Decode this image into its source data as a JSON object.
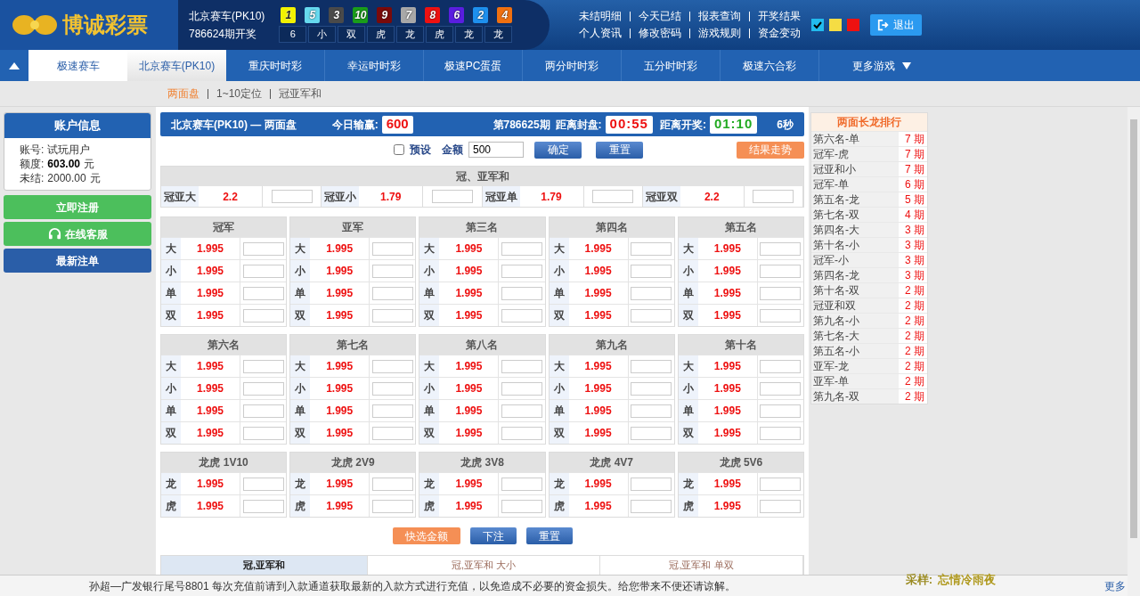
{
  "header": {
    "logo": "博诚彩票",
    "game": "北京赛车(PK10)",
    "issue": "786624期开奖",
    "balls": [
      {
        "number": "1",
        "color": "#f2f200"
      },
      {
        "number": "5",
        "color": "#66d9ee"
      },
      {
        "number": "3",
        "color": "#4a4a4a"
      },
      {
        "number": "10",
        "color": "#1a9e1a"
      },
      {
        "number": "9",
        "color": "#7a0a0a"
      },
      {
        "number": "7",
        "color": "#a8a8a8"
      },
      {
        "number": "8",
        "color": "#ee1111"
      },
      {
        "number": "6",
        "color": "#5a1ee0"
      },
      {
        "number": "2",
        "color": "#1e90ee"
      },
      {
        "number": "4",
        "color": "#f07010"
      }
    ],
    "stats": [
      "6",
      "小",
      "双",
      "虎",
      "龙",
      "虎",
      "龙",
      "龙"
    ],
    "links": [
      [
        "未结明细",
        "今天已结",
        "报表查询",
        "开奖结果"
      ],
      [
        "个人资讯",
        "修改密码",
        "游戏规则",
        "资金变动"
      ]
    ],
    "swatches": [
      {
        "color": "#22bbee",
        "selected": true
      },
      {
        "color": "#f5dd44",
        "selected": false
      },
      {
        "color": "#ee1111",
        "selected": false
      }
    ],
    "logout": "退出"
  },
  "nav": {
    "tabs": [
      {
        "label": "极速赛车",
        "selected": false
      },
      {
        "label": "北京赛车(PK10)",
        "selected": true
      },
      {
        "label": "重庆时时彩",
        "selected": false
      },
      {
        "label": "幸运时时彩",
        "selected": false
      },
      {
        "label": "极速PC蛋蛋",
        "selected": false
      },
      {
        "label": "两分时时彩",
        "selected": false
      },
      {
        "label": "五分时时彩",
        "selected": false
      },
      {
        "label": "极速六合彩",
        "selected": false
      }
    ],
    "more": "更多游戏"
  },
  "subnav": [
    {
      "label": "两面盘",
      "selected": true
    },
    {
      "label": "1~10定位",
      "selected": false
    },
    {
      "label": "冠亚军和",
      "selected": false
    }
  ],
  "account": {
    "title": "账户信息",
    "rows": [
      {
        "label": "账号:",
        "value": "试玩用户",
        "unit": "",
        "bold": false
      },
      {
        "label": "额度:",
        "value": "603.00",
        "unit": "元",
        "bold": true
      },
      {
        "label": "未结:",
        "value": "2000.00",
        "unit": "元",
        "bold": false
      }
    ],
    "buttons": [
      {
        "label": "立即注册",
        "color": "#4cbf5c",
        "icon": false
      },
      {
        "label": "在线客服",
        "color": "#4cbf5c",
        "icon": true
      },
      {
        "label": "最新注单",
        "color": "#2a5ea8",
        "icon": false
      }
    ]
  },
  "bar": {
    "title": "北京赛车(PK10) — 两面盘",
    "profit_label": "今日输赢:",
    "profit": "600",
    "period": "第786625期",
    "close_label": "距离封盘:",
    "close": "00:55",
    "draw_label": "距离开奖:",
    "draw": "01:10",
    "refresh": "6秒"
  },
  "toolbar": {
    "preset_checked": false,
    "preset": "预设",
    "amount_label": "金额",
    "amount": "500",
    "confirm": "确定",
    "reset": "重置",
    "trend": "结果走势"
  },
  "sum": {
    "title": "冠、亚军和",
    "items": [
      {
        "label": "冠亚大",
        "odds": "2.2"
      },
      {
        "label": "冠亚小",
        "odds": "1.79"
      },
      {
        "label": "冠亚单",
        "odds": "1.79"
      },
      {
        "label": "冠亚双",
        "odds": "2.2"
      }
    ]
  },
  "positions": [
    {
      "title": "冠军",
      "rows": [
        {
          "label": "大",
          "odds": "1.995"
        },
        {
          "label": "小",
          "odds": "1.995"
        },
        {
          "label": "单",
          "odds": "1.995"
        },
        {
          "label": "双",
          "odds": "1.995"
        }
      ]
    },
    {
      "title": "亚军",
      "rows": [
        {
          "label": "大",
          "odds": "1.995"
        },
        {
          "label": "小",
          "odds": "1.995"
        },
        {
          "label": "单",
          "odds": "1.995"
        },
        {
          "label": "双",
          "odds": "1.995"
        }
      ]
    },
    {
      "title": "第三名",
      "rows": [
        {
          "label": "大",
          "odds": "1.995"
        },
        {
          "label": "小",
          "odds": "1.995"
        },
        {
          "label": "单",
          "odds": "1.995"
        },
        {
          "label": "双",
          "odds": "1.995"
        }
      ]
    },
    {
      "title": "第四名",
      "rows": [
        {
          "label": "大",
          "odds": "1.995"
        },
        {
          "label": "小",
          "odds": "1.995"
        },
        {
          "label": "单",
          "odds": "1.995"
        },
        {
          "label": "双",
          "odds": "1.995"
        }
      ]
    },
    {
      "title": "第五名",
      "rows": [
        {
          "label": "大",
          "odds": "1.995"
        },
        {
          "label": "小",
          "odds": "1.995"
        },
        {
          "label": "单",
          "odds": "1.995"
        },
        {
          "label": "双",
          "odds": "1.995"
        }
      ]
    },
    {
      "title": "第六名",
      "rows": [
        {
          "label": "大",
          "odds": "1.995"
        },
        {
          "label": "小",
          "odds": "1.995"
        },
        {
          "label": "单",
          "odds": "1.995"
        },
        {
          "label": "双",
          "odds": "1.995"
        }
      ]
    },
    {
      "title": "第七名",
      "rows": [
        {
          "label": "大",
          "odds": "1.995"
        },
        {
          "label": "小",
          "odds": "1.995"
        },
        {
          "label": "单",
          "odds": "1.995"
        },
        {
          "label": "双",
          "odds": "1.995"
        }
      ]
    },
    {
      "title": "第八名",
      "rows": [
        {
          "label": "大",
          "odds": "1.995"
        },
        {
          "label": "小",
          "odds": "1.995"
        },
        {
          "label": "单",
          "odds": "1.995"
        },
        {
          "label": "双",
          "odds": "1.995"
        }
      ]
    },
    {
      "title": "第九名",
      "rows": [
        {
          "label": "大",
          "odds": "1.995"
        },
        {
          "label": "小",
          "odds": "1.995"
        },
        {
          "label": "单",
          "odds": "1.995"
        },
        {
          "label": "双",
          "odds": "1.995"
        }
      ]
    },
    {
      "title": "第十名",
      "rows": [
        {
          "label": "大",
          "odds": "1.995"
        },
        {
          "label": "小",
          "odds": "1.995"
        },
        {
          "label": "单",
          "odds": "1.995"
        },
        {
          "label": "双",
          "odds": "1.995"
        }
      ]
    }
  ],
  "dragon_tiger": [
    {
      "title": "龙虎 1V10",
      "rows": [
        {
          "label": "龙",
          "odds": "1.995"
        },
        {
          "label": "虎",
          "odds": "1.995"
        }
      ]
    },
    {
      "title": "龙虎 2V9",
      "rows": [
        {
          "label": "龙",
          "odds": "1.995"
        },
        {
          "label": "虎",
          "odds": "1.995"
        }
      ]
    },
    {
      "title": "龙虎 3V8",
      "rows": [
        {
          "label": "龙",
          "odds": "1.995"
        },
        {
          "label": "虎",
          "odds": "1.995"
        }
      ]
    },
    {
      "title": "龙虎 4V7",
      "rows": [
        {
          "label": "龙",
          "odds": "1.995"
        },
        {
          "label": "虎",
          "odds": "1.995"
        }
      ]
    },
    {
      "title": "龙虎 5V6",
      "rows": [
        {
          "label": "龙",
          "odds": "1.995"
        },
        {
          "label": "虎",
          "odds": "1.995"
        }
      ]
    }
  ],
  "actions": {
    "quick": "快选金额",
    "bet": "下注",
    "reset": "重置"
  },
  "results": {
    "tabs": [
      {
        "label": "冠,亚军和",
        "selected": true
      },
      {
        "label": "冠,亚军和 大小",
        "selected": false
      },
      {
        "label": "冠,亚军和 单双",
        "selected": false
      }
    ]
  },
  "ranking": {
    "title": "两面长龙排行",
    "rows": [
      {
        "name": "第六名-单",
        "count": "7 期"
      },
      {
        "name": "冠军-虎",
        "count": "7 期"
      },
      {
        "name": "冠亚和小",
        "count": "7 期"
      },
      {
        "name": "冠军-单",
        "count": "6 期"
      },
      {
        "name": "第五名-龙",
        "count": "5 期"
      },
      {
        "name": "第七名-双",
        "count": "4 期"
      },
      {
        "name": "第四名-大",
        "count": "3 期"
      },
      {
        "name": "第十名-小",
        "count": "3 期"
      },
      {
        "name": "冠军-小",
        "count": "3 期"
      },
      {
        "name": "第四名-龙",
        "count": "3 期"
      },
      {
        "name": "第十名-双",
        "count": "2 期"
      },
      {
        "name": "冠亚和双",
        "count": "2 期"
      },
      {
        "name": "第九名-小",
        "count": "2 期"
      },
      {
        "name": "第七名-大",
        "count": "2 期"
      },
      {
        "name": "第五名-小",
        "count": "2 期"
      },
      {
        "name": "亚军-龙",
        "count": "2 期"
      },
      {
        "name": "亚军-单",
        "count": "2 期"
      },
      {
        "name": "第九名-双",
        "count": "2 期"
      }
    ]
  },
  "ticker": {
    "text": "孙超—广发银行尾号8801 每次充值前请到入款通道获取最新的入款方式进行充值，以免造成不必要的资金损失。给您带来不便还请谅解。",
    "sample_label": "采样:",
    "sample": "忘情冷雨夜",
    "more": "更多"
  }
}
